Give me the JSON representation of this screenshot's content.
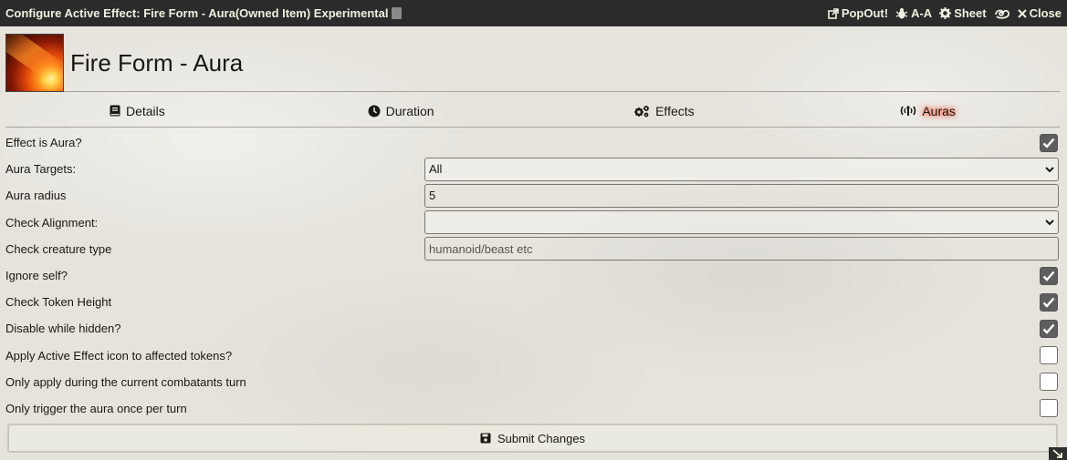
{
  "window": {
    "title": "Configure Active Effect: Fire Form - Aura(Owned Item) Experimental",
    "controls": [
      {
        "label": "PopOut!",
        "icon": "external-link-icon"
      },
      {
        "label": "A-A",
        "icon": "bug-icon"
      },
      {
        "label": "Sheet",
        "icon": "gear-icon"
      },
      {
        "label": "",
        "icon": "swirl-icon"
      },
      {
        "label": "Close",
        "icon": "close-icon"
      }
    ]
  },
  "header": {
    "name": "Fire Form - Aura"
  },
  "tabs": [
    {
      "label": "Details",
      "icon": "book-icon",
      "active": false
    },
    {
      "label": "Duration",
      "icon": "clock-icon",
      "active": false
    },
    {
      "label": "Effects",
      "icon": "cogs-icon",
      "active": false
    },
    {
      "label": "Auras",
      "icon": "broadcast-tower-icon",
      "active": true
    }
  ],
  "form": {
    "effect_is_aura": {
      "label": "Effect is Aura?",
      "checked": true
    },
    "aura_targets": {
      "label": "Aura Targets:",
      "value": "All"
    },
    "aura_radius": {
      "label": "Aura radius",
      "value": "5"
    },
    "check_alignment": {
      "label": "Check Alignment:",
      "value": ""
    },
    "check_creature_type": {
      "label": "Check creature type",
      "placeholder": "humanoid/beast etc"
    },
    "ignore_self": {
      "label": "Ignore self?",
      "checked": true
    },
    "check_token_height": {
      "label": "Check Token Height",
      "checked": true
    },
    "disable_while_hidden": {
      "label": "Disable while hidden?",
      "checked": true
    },
    "apply_icon": {
      "label": "Apply Active Effect icon to affected tokens?",
      "checked": false
    },
    "only_current_turn": {
      "label": "Only apply during the current combatants turn",
      "checked": false
    },
    "trigger_once": {
      "label": "Only trigger the aura once per turn",
      "checked": false
    }
  },
  "submit": {
    "label": "Submit Changes"
  }
}
